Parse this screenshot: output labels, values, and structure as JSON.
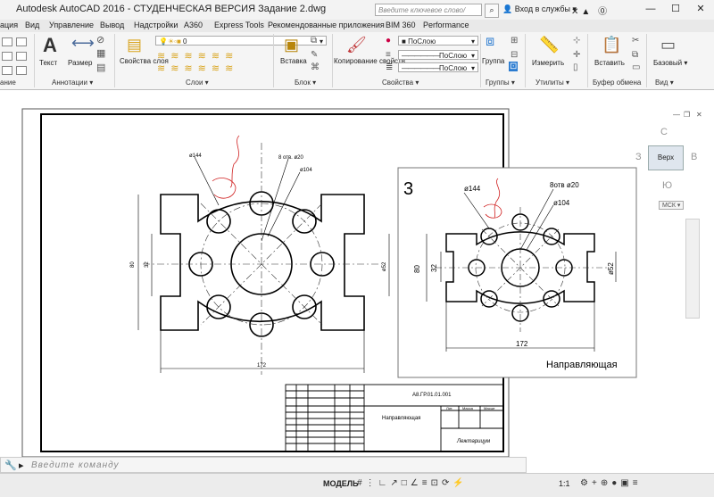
{
  "titlebar": {
    "title": "Autodesk AutoCAD 2016 - СТУДЕНЧЕСКАЯ ВЕРСИЯ     Задание 2.dwg",
    "search_placeholder": "Введите ключевое слово/фразу",
    "login": "Вход в службы",
    "help": "?"
  },
  "menu": {
    "items": [
      "ация",
      "Вид",
      "Управление",
      "Вывод",
      "Надстройки",
      "A360",
      "Express Tools",
      "Рекомендованные приложения",
      "BIM 360",
      "Performance"
    ]
  },
  "ribbon": {
    "text_label": "Текст",
    "dimension_label": "Размер",
    "layer_props_label": "Свойства слоя",
    "layer_value": "0",
    "insert_label": "Вставка",
    "match_props_label": "Копирование свойств",
    "color_value": "ПоСлою",
    "linetype_value": "ПоСлою",
    "lineweight_value": "ПоСлою",
    "group_label": "Группа",
    "measure_label": "Измерить",
    "paste_label": "Вставить",
    "base_label": "Базовый",
    "panels": {
      "p0": "ание",
      "annotations": "Аннотации",
      "layers": "Слои",
      "block": "Блок",
      "properties": "Свойства",
      "groups": "Группы",
      "utilities": "Утилиты",
      "clipboard": "Буфер обмена",
      "view": "Вид"
    }
  },
  "navcube": {
    "top": "Верх",
    "north": "С",
    "south": "Ю",
    "west": "З",
    "east": "В",
    "wcs": "МСК"
  },
  "drawing": {
    "d144": "ø144",
    "holes": "8 отв. ø20",
    "d104": "ø104",
    "dim80": "80",
    "dim32": "32",
    "dim52": "ø52",
    "dim172": "172",
    "title_block": {
      "code": "А8.ГР.01.01.001",
      "name": "Направляющая",
      "lit": "Лит.",
      "mass": "Масса",
      "scale": "Масшт",
      "author": "Лежтарицум"
    }
  },
  "reference": {
    "number": "3",
    "d144": "ø144",
    "holes": "8отв ø20",
    "d104": "ø104",
    "dim80": "80",
    "dim32": "32",
    "dim52": "ø52",
    "dim172": "172",
    "caption": "Направляющая"
  },
  "command": {
    "placeholder": "Введите команду"
  },
  "status": {
    "mode": "МОДЕЛЬ",
    "scale": "1:1"
  }
}
